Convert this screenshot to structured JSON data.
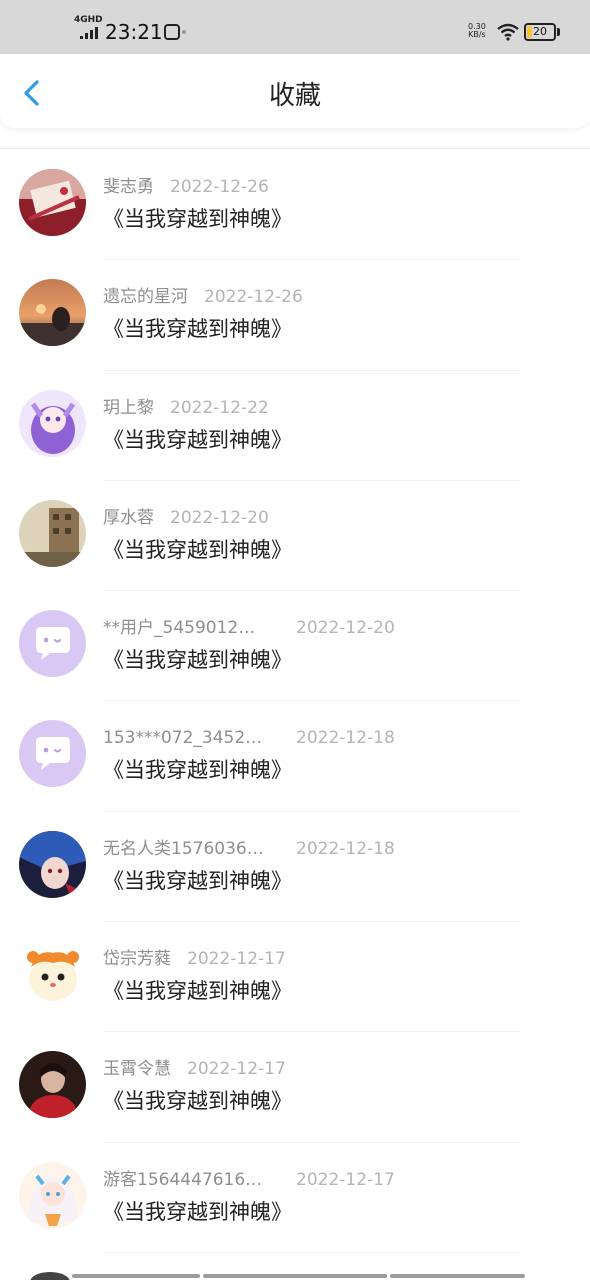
{
  "status_bar": {
    "network": "4GHD",
    "time": "23:21",
    "speed_value": "0.30",
    "speed_unit": "KB/s",
    "battery": "20",
    "icons": [
      "signal-icon",
      "app-icon",
      "wifi-icon",
      "battery-icon"
    ]
  },
  "nav": {
    "back_icon": "chevron-left-icon",
    "title": "收藏"
  },
  "colors": {
    "accent": "#2f9ae8",
    "username_gray": "#8e8e8e",
    "date_gray": "#b4b4b4",
    "title_dark": "#222222",
    "status_bar_bg": "#d8d8d8",
    "battery_fill": "#f6c33b",
    "default_avatar_bg": "#d9c8f3"
  },
  "favorites": [
    {
      "user": "斐志勇",
      "date": "2022-12-26",
      "book": "《当我穿越到神魄》",
      "avatar": "photo-red-book"
    },
    {
      "user": "遗忘的星河",
      "date": "2022-12-26",
      "book": "《当我穿越到神魄》",
      "avatar": "photo-sunset"
    },
    {
      "user": "玥上黎",
      "date": "2022-12-22",
      "book": "《当我穿越到神魄》",
      "avatar": "anime-purple"
    },
    {
      "user": "厚水蓉",
      "date": "2022-12-20",
      "book": "《当我穿越到神魄》",
      "avatar": "photo-building"
    },
    {
      "user": "**用户_5459012…",
      "date": "2022-12-20",
      "book": "《当我穿越到神魄》",
      "avatar": "default-chat"
    },
    {
      "user": "153***072_3452…",
      "date": "2022-12-18",
      "book": "《当我穿越到神魄》",
      "avatar": "default-chat"
    },
    {
      "user": "无名人类1576036…",
      "date": "2022-12-18",
      "book": "《当我穿越到神魄》",
      "avatar": "anime-blue-red"
    },
    {
      "user": "岱宗芳蕤",
      "date": "2022-12-17",
      "book": "《当我穿越到神魄》",
      "avatar": "cartoon-hamster"
    },
    {
      "user": "玉霄令慧",
      "date": "2022-12-17",
      "book": "《当我穿越到神魄》",
      "avatar": "photo-person-red"
    },
    {
      "user": "游客1564447616…",
      "date": "2022-12-17",
      "book": "《当我穿越到神魄》",
      "avatar": "anime-girl-white"
    }
  ]
}
